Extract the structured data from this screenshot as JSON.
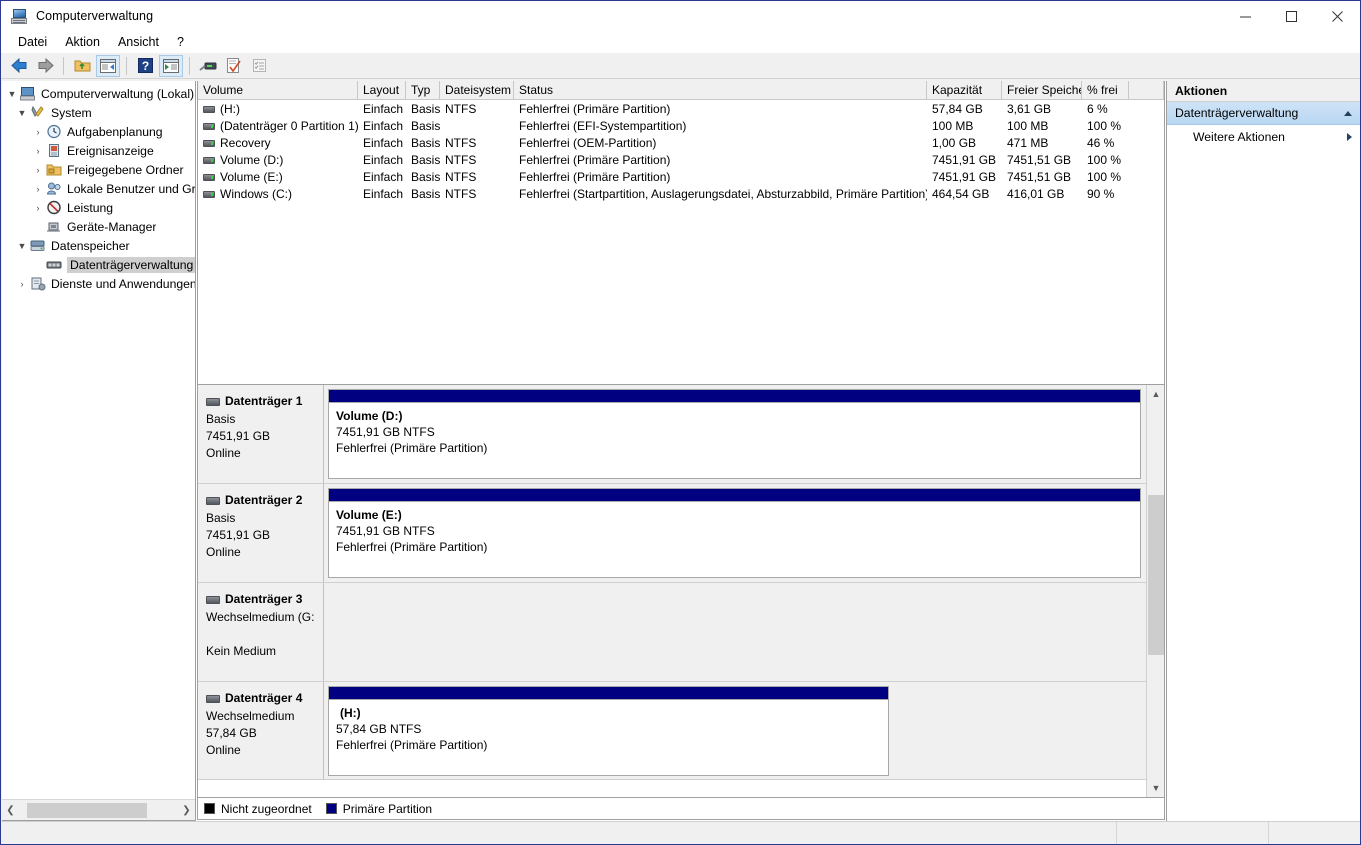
{
  "window": {
    "title": "Computerverwaltung",
    "icon": "computer-management-icon",
    "minimize": "─",
    "maximize": "□",
    "close": "✕"
  },
  "menubar": {
    "items": [
      {
        "label": "Datei"
      },
      {
        "label": "Aktion"
      },
      {
        "label": "Ansicht"
      },
      {
        "label": "?"
      }
    ]
  },
  "toolbar": {
    "buttons": [
      {
        "name": "back-icon",
        "label": "Zurück"
      },
      {
        "name": "forward-icon",
        "label": "Vorwärts"
      },
      {
        "name": "up-folder-icon",
        "label": "Eine Ebene nach oben"
      },
      {
        "name": "show-hide-console-tree-icon",
        "label": "Konsolenstruktur ein-/ausblenden"
      },
      {
        "name": "help-icon",
        "label": "Hilfe"
      },
      {
        "name": "show-action-pane-icon",
        "label": "Aktionsbereich anzeigen"
      },
      {
        "name": "refresh-icon",
        "label": "Aktualisieren"
      },
      {
        "name": "properties-icon",
        "label": "Eigenschaften"
      },
      {
        "name": "list-view-icon",
        "label": "Listenansicht"
      }
    ]
  },
  "tree": {
    "nodes": [
      {
        "label": "Computerverwaltung (Lokal)",
        "indent": 0,
        "twist": "▼",
        "icon": "computer-icon",
        "selected": false
      },
      {
        "label": "System",
        "indent": 1,
        "twist": "▼",
        "icon": "tools-icon",
        "selected": false
      },
      {
        "label": "Aufgabenplanung",
        "indent": 2,
        "twist": "›",
        "icon": "clock-icon",
        "selected": false
      },
      {
        "label": "Ereignisanzeige",
        "indent": 2,
        "twist": "›",
        "icon": "eventlog-icon",
        "selected": false
      },
      {
        "label": "Freigegebene Ordner",
        "indent": 2,
        "twist": "›",
        "icon": "shared-folder-icon",
        "selected": false
      },
      {
        "label": "Lokale Benutzer und Gr",
        "indent": 2,
        "twist": "›",
        "icon": "users-icon",
        "selected": false
      },
      {
        "label": "Leistung",
        "indent": 2,
        "twist": "›",
        "icon": "performance-icon",
        "selected": false
      },
      {
        "label": "Geräte-Manager",
        "indent": 2,
        "twist": "",
        "icon": "device-manager-icon",
        "selected": false
      },
      {
        "label": "Datenspeicher",
        "indent": 1,
        "twist": "▼",
        "icon": "storage-icon",
        "selected": false
      },
      {
        "label": "Datenträgerverwaltung",
        "indent": 2,
        "twist": "",
        "icon": "disk-management-icon",
        "selected": true
      },
      {
        "label": "Dienste und Anwendungen",
        "indent": 1,
        "twist": "›",
        "icon": "services-icon",
        "selected": false
      }
    ]
  },
  "volume_table": {
    "columns": [
      {
        "key": "volume",
        "label": "Volume"
      },
      {
        "key": "layout",
        "label": "Layout"
      },
      {
        "key": "type",
        "label": "Typ"
      },
      {
        "key": "filesystem",
        "label": "Dateisystem"
      },
      {
        "key": "status",
        "label": "Status"
      },
      {
        "key": "capacity",
        "label": "Kapazität"
      },
      {
        "key": "free",
        "label": "Freier Speicher"
      },
      {
        "key": "pctfree",
        "label": "% frei"
      }
    ],
    "rows": [
      {
        "volume": "(H:)",
        "icon": "volume-icon-plain",
        "layout": "Einfach",
        "type": "Basis",
        "filesystem": "NTFS",
        "status": "Fehlerfrei (Primäre Partition)",
        "capacity": "57,84 GB",
        "free": "3,61 GB",
        "pctfree": "6 %"
      },
      {
        "volume": "(Datenträger 0 Partition 1)",
        "icon": "volume-icon-green",
        "layout": "Einfach",
        "type": "Basis",
        "filesystem": "",
        "status": "Fehlerfrei (EFI-Systempartition)",
        "capacity": "100 MB",
        "free": "100 MB",
        "pctfree": "100 %"
      },
      {
        "volume": "Recovery",
        "icon": "volume-icon-green",
        "layout": "Einfach",
        "type": "Basis",
        "filesystem": "NTFS",
        "status": "Fehlerfrei (OEM-Partition)",
        "capacity": "1,00 GB",
        "free": "471 MB",
        "pctfree": "46 %"
      },
      {
        "volume": "Volume (D:)",
        "icon": "volume-icon-green",
        "layout": "Einfach",
        "type": "Basis",
        "filesystem": "NTFS",
        "status": "Fehlerfrei (Primäre Partition)",
        "capacity": "7451,91 GB",
        "free": "7451,51 GB",
        "pctfree": "100 %"
      },
      {
        "volume": "Volume (E:)",
        "icon": "volume-icon-green",
        "layout": "Einfach",
        "type": "Basis",
        "filesystem": "NTFS",
        "status": "Fehlerfrei (Primäre Partition)",
        "capacity": "7451,91 GB",
        "free": "7451,51 GB",
        "pctfree": "100 %"
      },
      {
        "volume": "Windows (C:)",
        "icon": "volume-icon-green",
        "layout": "Einfach",
        "type": "Basis",
        "filesystem": "NTFS",
        "status": "Fehlerfrei (Startpartition, Auslagerungsdatei, Absturzabbild, Primäre Partition)",
        "capacity": "464,54 GB",
        "free": "416,01 GB",
        "pctfree": "90 %"
      }
    ]
  },
  "disks": [
    {
      "name": "Datenträger 1",
      "type": "Basis",
      "size": "7451,91 GB",
      "state": "Online",
      "partitions": [
        {
          "name": "Volume  (D:)",
          "size_fs": "7451,91 GB NTFS",
          "status": "Fehlerfrei (Primäre Partition)",
          "width_pct": 100,
          "bar_color": "#000080"
        }
      ]
    },
    {
      "name": "Datenträger 2",
      "type": "Basis",
      "size": "7451,91 GB",
      "state": "Online",
      "partitions": [
        {
          "name": "Volume  (E:)",
          "size_fs": "7451,91 GB NTFS",
          "status": "Fehlerfrei (Primäre Partition)",
          "width_pct": 100,
          "bar_color": "#000080"
        }
      ]
    },
    {
      "name": "Datenträger 3",
      "type": "Wechselmedium (G:",
      "size": "",
      "state": "Kein Medium",
      "partitions": []
    },
    {
      "name": "Datenträger 4",
      "type": "Wechselmedium",
      "size": "57,84 GB",
      "state": "Online",
      "partitions": [
        {
          "name": "(H:)",
          "size_fs": "57,84 GB NTFS",
          "status": "Fehlerfrei (Primäre Partition)",
          "width_pct": 69,
          "bar_color": "#000080"
        }
      ]
    }
  ],
  "legend": {
    "items": [
      {
        "label": "Nicht zugeordnet",
        "color": "#000000"
      },
      {
        "label": "Primäre Partition",
        "color": "#000080"
      }
    ]
  },
  "actions": {
    "header": "Aktionen",
    "group": "Datenträgerverwaltung",
    "items": [
      {
        "label": "Weitere Aktionen",
        "submenu": true
      }
    ]
  },
  "statusbar": {
    "text": ""
  },
  "colors": {
    "primary_partition": "#000080",
    "unallocated": "#000000",
    "selection": "#cfcfcf",
    "action_group": "#b9d7f2",
    "window_border": "#2b3a8f"
  }
}
